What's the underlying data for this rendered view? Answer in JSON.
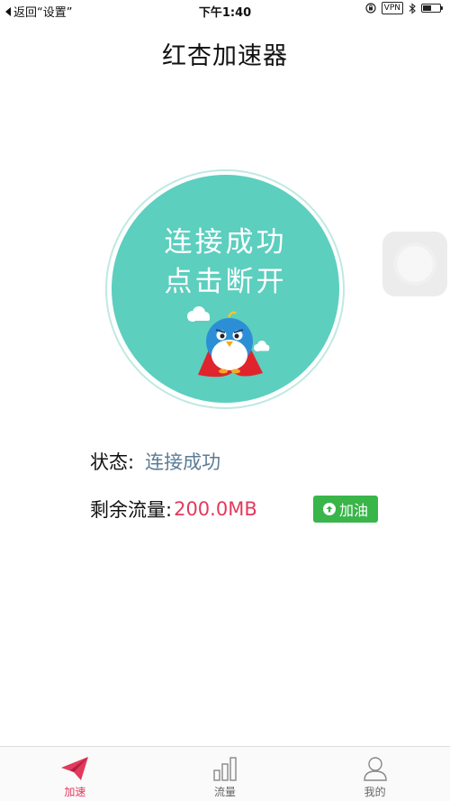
{
  "status_bar": {
    "back_label": "返回“设置”",
    "time": "下午1:40",
    "vpn": "VPN"
  },
  "header": {
    "title": "红杏加速器"
  },
  "connect_button": {
    "line1": "连接成功",
    "line2": "点击断开"
  },
  "info": {
    "status_label": "状态:",
    "status_value": "连接成功",
    "traffic_label": "剩余流量:",
    "traffic_value": "200.0MB",
    "refuel_label": "加油"
  },
  "tabs": [
    {
      "label": "加速",
      "icon": "paper-plane-icon",
      "active": true
    },
    {
      "label": "流量",
      "icon": "bar-chart-icon",
      "active": false
    },
    {
      "label": "我的",
      "icon": "user-icon",
      "active": false
    }
  ],
  "colors": {
    "accent": "#e23a5c",
    "circle": "#5ccfbf",
    "refuel": "#39b54a",
    "status_value": "#5c7c95"
  }
}
